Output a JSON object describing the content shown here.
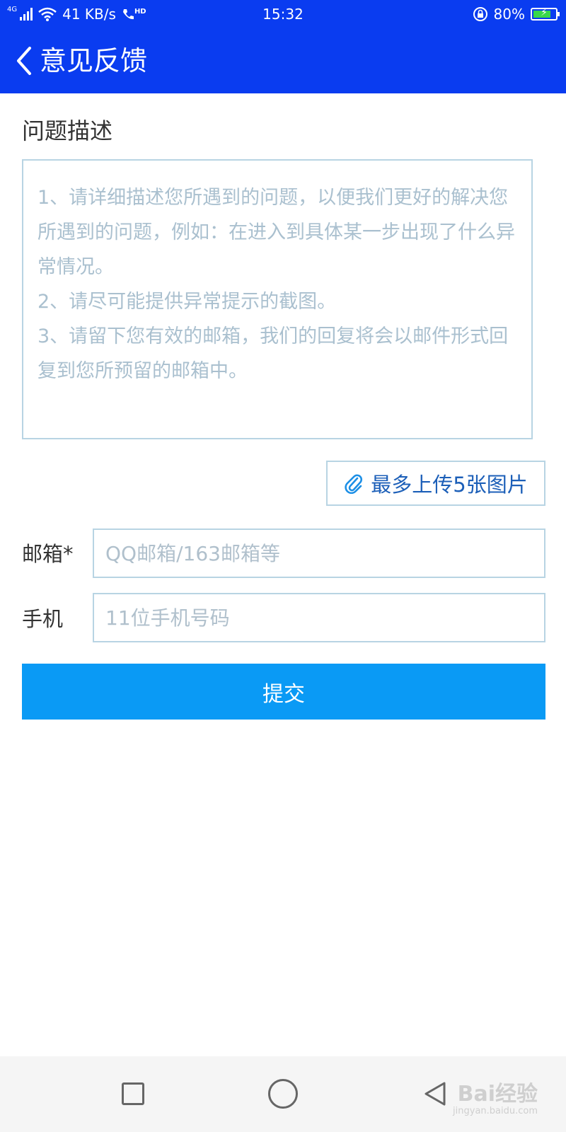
{
  "status_bar": {
    "network": "4G",
    "speed": "41 KB/s",
    "call_hd": "HD",
    "time": "15:32",
    "battery_percent": "80%",
    "battery_level": 0.8
  },
  "app_bar": {
    "title": "意见反馈"
  },
  "problem": {
    "section_title": "问题描述",
    "placeholder_lines": [
      "1、请详细描述您所遇到的问题，以便我们更好的解决您所遇到的问题，例如：在进入到具体某一步出现了什么异常情况。",
      "2、请尽可能提供异常提示的截图。",
      "3、请留下您有效的邮箱，我们的回复将会以邮件形式回复到您所预留的邮箱中。"
    ]
  },
  "upload": {
    "label": "最多上传5张图片",
    "icon": "paperclip-icon"
  },
  "email": {
    "label": "邮箱*",
    "placeholder": "QQ邮箱/163邮箱等",
    "value": ""
  },
  "phone": {
    "label": "手机",
    "placeholder": "11位手机号码",
    "value": ""
  },
  "submit": {
    "label": "提交"
  },
  "watermark": {
    "text": "Bai经验",
    "url": "jingyan.baidu.com"
  },
  "colors": {
    "primary": "#0a3cf0",
    "button": "#0a9af5",
    "border": "#b8d4e3"
  }
}
